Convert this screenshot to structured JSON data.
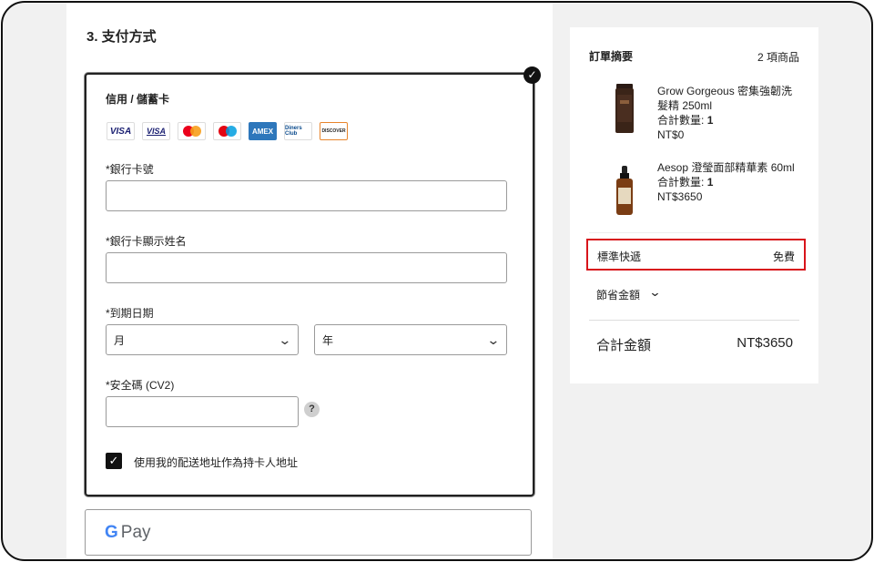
{
  "checkout": {
    "section_title": "3. 支付方式",
    "card": {
      "title": "信用 / 儲蓄卡",
      "brands": [
        "VISA",
        "VISA",
        "Mastercard",
        "Maestro",
        "AMEX",
        "Diners Club",
        "DISCOVER"
      ],
      "card_number_label": "*銀行卡號",
      "card_number_value": "",
      "name_label": "*銀行卡顯示姓名",
      "name_value": "",
      "expiry_label": "*到期日期",
      "month_value": "月",
      "year_value": "年",
      "cvv_label": "*安全碼 (CV2)",
      "cvv_value": "",
      "help_glyph": "?",
      "same_address_label": "使用我的配送地址作為持卡人地址",
      "same_address_checked": true
    },
    "gpay": {
      "g": "G",
      "pay": "Pay"
    }
  },
  "summary": {
    "title": "訂單摘要",
    "count": "2 項商品",
    "items": [
      {
        "name": "Grow Gorgeous 密集強韌洗髮精 250ml",
        "qty_label": "合計數量:",
        "qty": "1",
        "price": "NT$0"
      },
      {
        "name": "Aesop 澄瑩面部精華素 60ml",
        "qty_label": "合計數量:",
        "qty": "1",
        "price": "NT$3650"
      }
    ],
    "shipping_label": "標準快遞",
    "shipping_value": "免費",
    "savings_label": "節省金額",
    "total_label": "合計金額",
    "total_value": "NT$3650"
  },
  "colors": {
    "highlight": "#d8141b",
    "background": "#f1f1f1"
  }
}
